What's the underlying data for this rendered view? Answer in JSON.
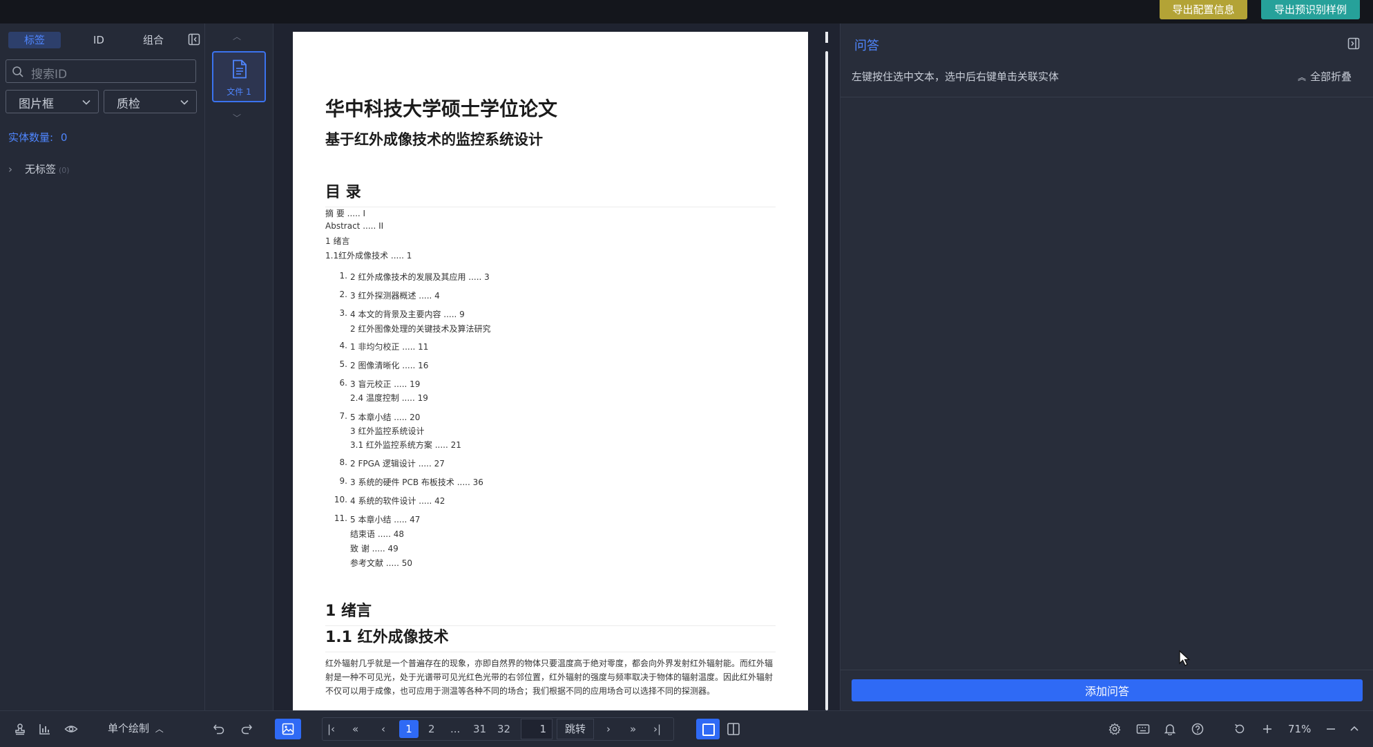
{
  "topbar": {
    "export_config": "导出配置信息",
    "export_sample": "导出预识别样例"
  },
  "left": {
    "tabs": [
      "标签",
      "ID",
      "组合"
    ],
    "search_placeholder": "搜索ID",
    "select1": "图片框",
    "select2": "质检",
    "entity_count_label": "实体数量:",
    "entity_count_value": "0",
    "tree_item": "无标签",
    "tree_item_count": "(0)"
  },
  "thumbs": {
    "file_label": "文件 1"
  },
  "doc": {
    "title": "华中科技大学硕士学位论文",
    "subtitle": "基于红外成像技术的监控系统设计",
    "toc_heading": "目 录",
    "toc_plain": [
      "摘 要 ..... I",
      "Abstract ..... II",
      "1 绪言",
      "1.1红外成像技术 ..... 1"
    ],
    "toc_list": [
      {
        "num": "1.",
        "lines": [
          "2 红外成像技术的发展及其应用 ..... 3"
        ]
      },
      {
        "num": "2.",
        "lines": [
          "3 红外探测器概述 ..... 4"
        ]
      },
      {
        "num": "3.",
        "lines": [
          "4 本文的背景及主要内容 ..... 9",
          "2 红外图像处理的关键技术及算法研究"
        ]
      },
      {
        "num": "4.",
        "lines": [
          "1 非均匀校正 ..... 11"
        ]
      },
      {
        "num": "5.",
        "lines": [
          "2 图像清晰化 ..... 16"
        ]
      },
      {
        "num": "6.",
        "lines": [
          "3 盲元校正 ..... 19",
          "2.4 温度控制 ..... 19"
        ]
      },
      {
        "num": "7.",
        "lines": [
          "5 本章小结 ..... 20",
          "3 红外监控系统设计",
          "3.1 红外监控系统方案 ..... 21"
        ]
      },
      {
        "num": "8.",
        "lines": [
          "2 FPGA 逻辑设计 ..... 27"
        ]
      },
      {
        "num": "9.",
        "lines": [
          "3 系统的硬件 PCB 布板技术 ..... 36"
        ]
      },
      {
        "num": "10.",
        "lines": [
          "4 系统的软件设计 ..... 42"
        ]
      },
      {
        "num": "11.",
        "lines": [
          "5 本章小结 ..... 47",
          "结束语 ..... 48",
          "致 谢 ..... 49",
          "参考文献 ..... 50"
        ]
      }
    ],
    "sec1": "1 绪言",
    "sec11": "1.1 红外成像技术",
    "paragraph": "红外辐射几乎就是一个普遍存在的现象，亦即自然界的物体只要温度高于绝对零度，都会向外界发射红外辐射能。而红外辐射是一种不可见光，处于光谱带可见光红色光带的右邻位置，红外辐射的强度与频率取决于物体的辐射温度。因此红外辐射不仅可以用于成像，也可应用于测温等各种不同的场合；我们根据不同的应用场合可以选择不同的探测器。"
  },
  "right": {
    "title": "问答",
    "hint": "左键按住选中文本，选中后右键单击关联实体",
    "fold_all": "全部折叠",
    "add_qa": "添加问答"
  },
  "bottom": {
    "draw_mode": "单个绘制",
    "pages": [
      "1",
      "2",
      "...",
      "31",
      "32"
    ],
    "page_input": "1",
    "jump": "跳转",
    "zoom": "71%"
  },
  "colors": {
    "accent": "#2f6af5",
    "export_config_bg": "#b3a336",
    "export_sample_bg": "#26a19a"
  }
}
